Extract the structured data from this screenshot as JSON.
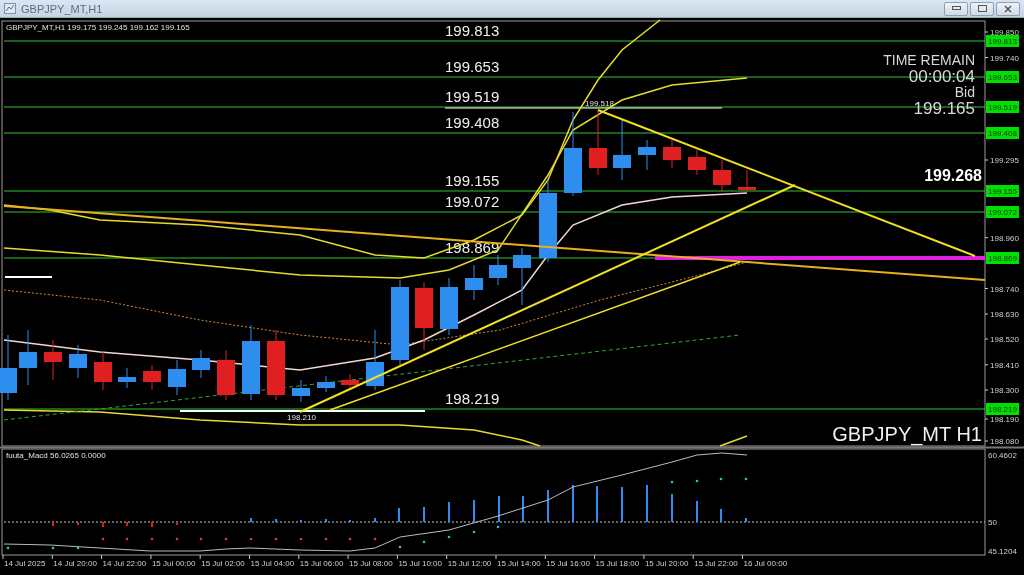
{
  "window": {
    "title": "GBPJPY_MT,H1"
  },
  "chart": {
    "info": "GBPJPY_MT,H1  199.175 199.245 199.162 199.165",
    "price_axis": [
      "199.850",
      "199.740",
      "199.295",
      "198.960",
      "198.740",
      "198.630",
      "198.520",
      "198.410",
      "198.300",
      "198.190",
      "198.080"
    ],
    "levels": [
      {
        "label": "199.813",
        "tag": "199.813"
      },
      {
        "label": "199.653",
        "tag": "199.653"
      },
      {
        "label": "199.519",
        "tag": "199.519"
      },
      {
        "label": "199.408",
        "tag": "199.408"
      },
      {
        "label": "199.155",
        "tag": "199.155"
      },
      {
        "label": "199.072",
        "tag": "199.072"
      },
      {
        "label": "198.869",
        "tag": "198.869"
      },
      {
        "label": "198.219",
        "tag": "198.219"
      }
    ],
    "high_label": "199.518",
    "low_label": "198.210",
    "timer": {
      "title": "TIME REMAIN",
      "value": "00:00:04",
      "bid_label": "Bid",
      "bid": "199.165"
    },
    "current_price": "199.268",
    "symbol_label": "GBPJPY_MT H1"
  },
  "macd": {
    "info": "fuuta_Macd 56.0265  0.0000",
    "axis": [
      "60.4602",
      "50",
      "45.1204"
    ]
  },
  "time_axis": [
    "14 Jul 2025",
    "14 Jul 20:00",
    "14 Jul 22:00",
    "15 Jul 00:00",
    "15 Jul 02:00",
    "15 Jul 04:00",
    "15 Jul 06:00",
    "15 Jul 08:00",
    "15 Jul 10:00",
    "15 Jul 12:00",
    "15 Jul 14:00",
    "15 Jul 16:00",
    "15 Jul 18:00",
    "15 Jul 20:00",
    "15 Jul 22:00",
    "16 Jul 00:00"
  ]
}
